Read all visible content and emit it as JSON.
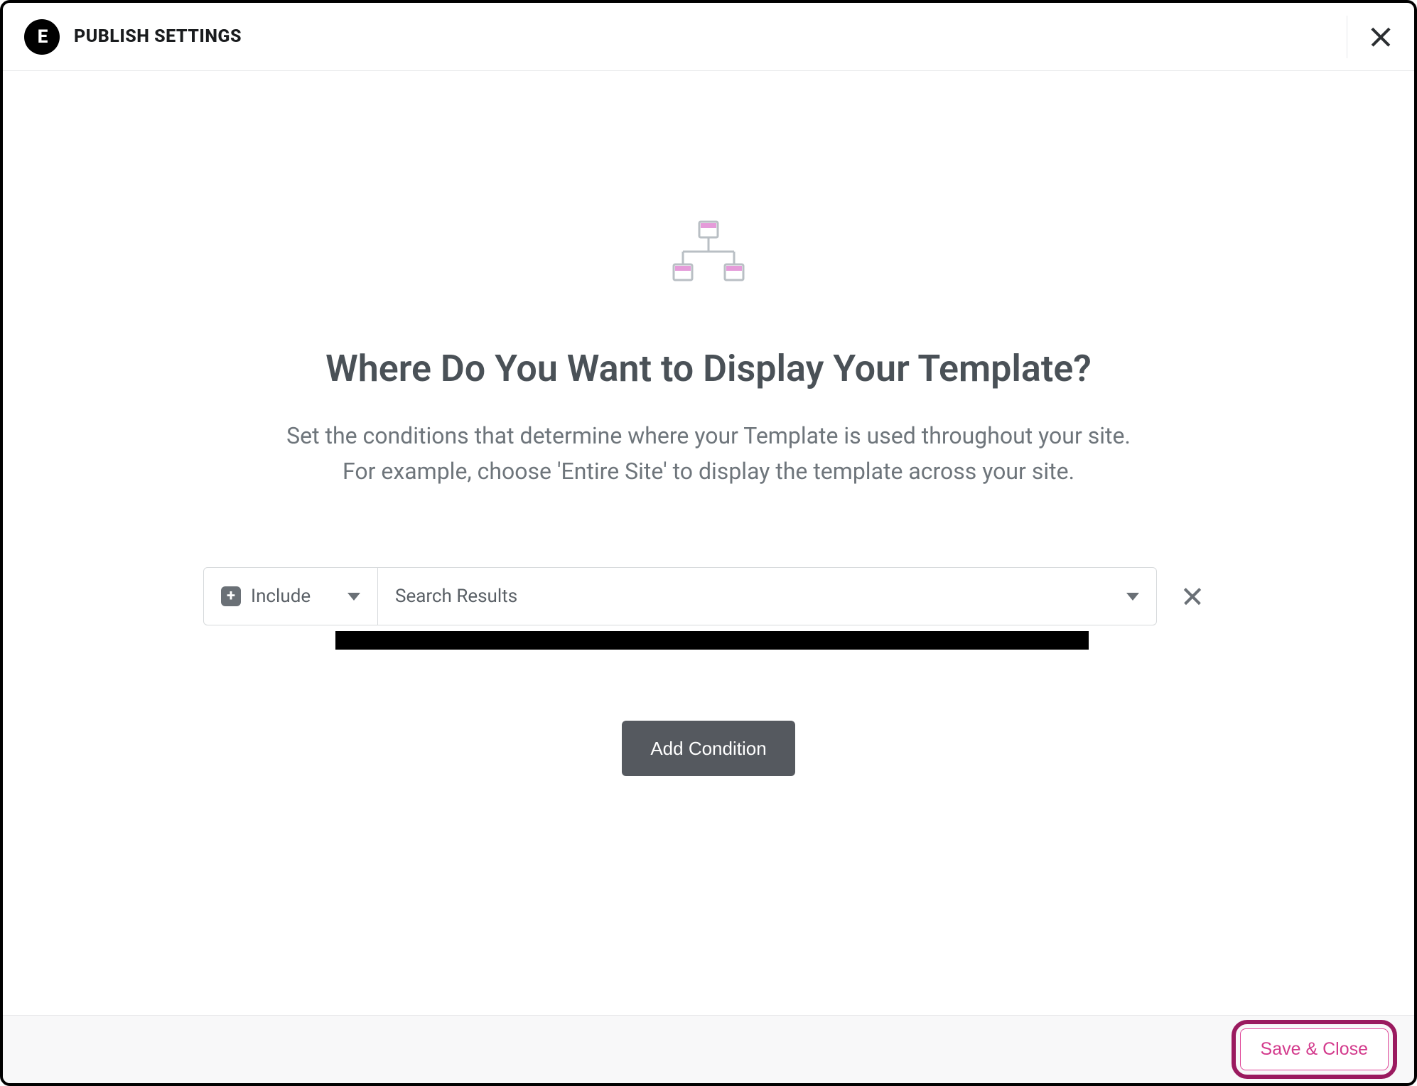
{
  "header": {
    "logo_text": "E",
    "title": "PUBLISH SETTINGS"
  },
  "main": {
    "heading": "Where Do You Want to Display Your Template?",
    "description_line1": "Set the conditions that determine where your Template is used throughout your site.",
    "description_line2": "For example, choose 'Entire Site' to display the template across your site."
  },
  "condition": {
    "mode": "Include",
    "scope": "Search Results"
  },
  "buttons": {
    "add_condition": "Add Condition",
    "save_close": "Save & Close"
  }
}
